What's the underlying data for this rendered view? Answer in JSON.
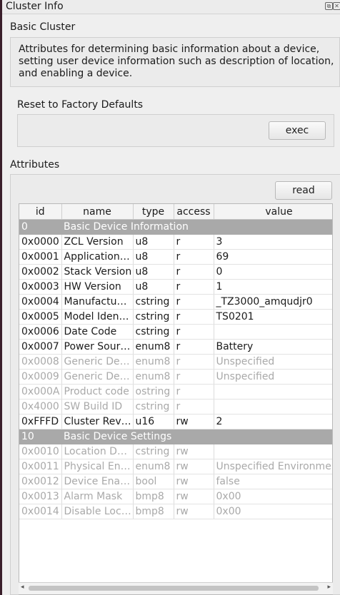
{
  "window": {
    "title": "Cluster Info",
    "float_glyph": "⧉",
    "close_glyph": "✕"
  },
  "basic_cluster": {
    "title": "Basic Cluster",
    "description": "Attributes for determining basic information about a device, setting user device information such as description of location, and enabling a device."
  },
  "reset": {
    "title": "Reset to Factory Defaults",
    "exec_label": "exec"
  },
  "attributes": {
    "title": "Attributes",
    "read_label": "read",
    "columns": [
      "id",
      "name",
      "type",
      "access",
      "value"
    ],
    "rows": [
      {
        "kind": "section",
        "id": "0",
        "name": "Basic Device Information"
      },
      {
        "kind": "enabled",
        "id": "0x0000",
        "name": "ZCL Version",
        "type": "u8",
        "access": "r",
        "value": "3"
      },
      {
        "kind": "enabled",
        "id": "0x0001",
        "name": "Application…",
        "type": "u8",
        "access": "r",
        "value": "69"
      },
      {
        "kind": "enabled",
        "id": "0x0002",
        "name": "Stack Version",
        "type": "u8",
        "access": "r",
        "value": "0"
      },
      {
        "kind": "enabled",
        "id": "0x0003",
        "name": "HW Version",
        "type": "u8",
        "access": "r",
        "value": "1"
      },
      {
        "kind": "enabled",
        "id": "0x0004",
        "name": "Manufactu…",
        "type": "cstring",
        "access": "r",
        "value": "_TZ3000_amqudjr0"
      },
      {
        "kind": "enabled",
        "id": "0x0005",
        "name": "Model Iden…",
        "type": "cstring",
        "access": "r",
        "value": "TS0201"
      },
      {
        "kind": "enabled",
        "id": "0x0006",
        "name": "Date Code",
        "type": "cstring",
        "access": "r",
        "value": ""
      },
      {
        "kind": "enabled",
        "id": "0x0007",
        "name": "Power Sour…",
        "type": "enum8",
        "access": "r",
        "value": "Battery"
      },
      {
        "kind": "disabled",
        "id": "0x0008",
        "name": "Generic De…",
        "type": "enum8",
        "access": "r",
        "value": "Unspecified"
      },
      {
        "kind": "disabled",
        "id": "0x0009",
        "name": "Generic De…",
        "type": "enum8",
        "access": "r",
        "value": "Unspecified"
      },
      {
        "kind": "disabled",
        "id": "0x000A",
        "name": "Product code",
        "type": "ostring",
        "access": "r",
        "value": ""
      },
      {
        "kind": "disabled",
        "id": "0x4000",
        "name": "SW Build ID",
        "type": "cstring",
        "access": "r",
        "value": ""
      },
      {
        "kind": "enabled",
        "id": "0xFFFD",
        "name": "Cluster Rev…",
        "type": "u16",
        "access": "rw",
        "value": "2"
      },
      {
        "kind": "section",
        "id": "10",
        "name": "Basic Device Settings"
      },
      {
        "kind": "disabled",
        "id": "0x0010",
        "name": "Location D…",
        "type": "cstring",
        "access": "rw",
        "value": ""
      },
      {
        "kind": "disabled",
        "id": "0x0011",
        "name": "Physical En…",
        "type": "enum8",
        "access": "rw",
        "value": "Unspecified Environment"
      },
      {
        "kind": "disabled",
        "id": "0x0012",
        "name": "Device Ena…",
        "type": "bool",
        "access": "rw",
        "value": "false"
      },
      {
        "kind": "disabled",
        "id": "0x0013",
        "name": "Alarm Mask",
        "type": "bmp8",
        "access": "rw",
        "value": "0x00"
      },
      {
        "kind": "disabled",
        "id": "0x0014",
        "name": "Disable Loc…",
        "type": "bmp8",
        "access": "rw",
        "value": "0x00"
      }
    ]
  },
  "scrollbar": {
    "left_glyph": "◂",
    "right_glyph": "▸"
  }
}
